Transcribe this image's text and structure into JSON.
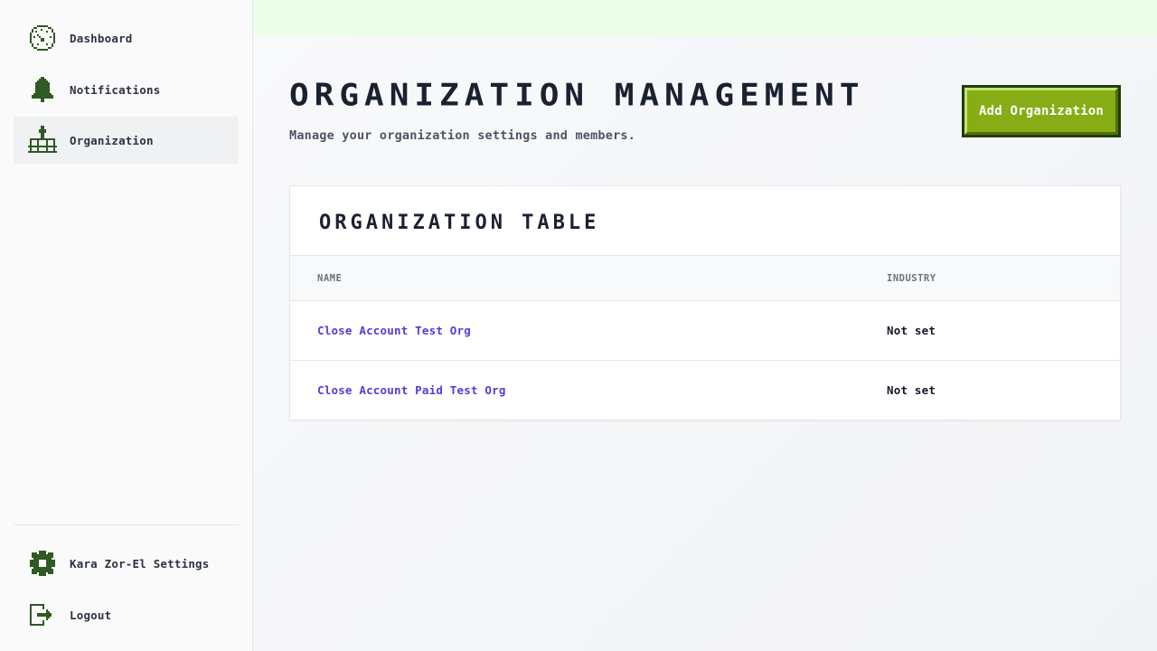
{
  "sidebar": {
    "nav": [
      {
        "label": "Dashboard",
        "icon": "dashboard-icon"
      },
      {
        "label": "Notifications",
        "icon": "bell-icon"
      },
      {
        "label": "Organization",
        "icon": "org-chart-icon",
        "active": true
      }
    ],
    "bottom": [
      {
        "label": "Kara Zor-El Settings",
        "icon": "gear-icon"
      },
      {
        "label": "Logout",
        "icon": "logout-icon"
      }
    ]
  },
  "header": {
    "title": "Organization Management",
    "subtitle": "Manage your organization settings and members.",
    "add_button_label": "Add Organization"
  },
  "table": {
    "title": "Organization Table",
    "columns": [
      "Name",
      "Industry"
    ],
    "rows": [
      {
        "name": "Close Account Test Org",
        "industry": "Not set"
      },
      {
        "name": "Close Account Paid Test Org",
        "industry": "Not set"
      }
    ]
  },
  "colors": {
    "accent_green": "#86ad16",
    "dark_green": "#1f3d0c",
    "icon_green": "#2f5a23",
    "link": "#4f3fd8",
    "topbar": "#ecfde8"
  }
}
